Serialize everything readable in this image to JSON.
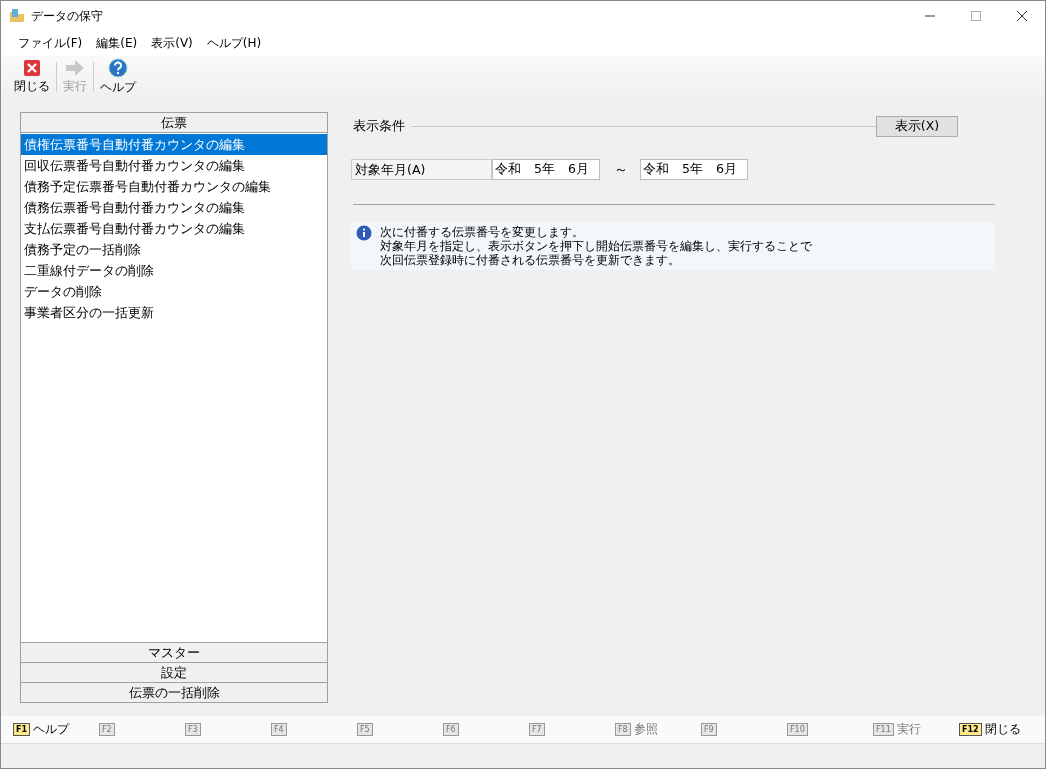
{
  "window": {
    "title": "データの保守"
  },
  "menu": [
    "ファイル(F)",
    "編集(E)",
    "表示(V)",
    "ヘルプ(H)"
  ],
  "toolbar": [
    {
      "kind": "close",
      "label": "閉じる",
      "disabled": false
    },
    {
      "kind": "run",
      "label": "実行",
      "disabled": true
    },
    {
      "kind": "help",
      "label": "ヘルプ",
      "disabled": false
    }
  ],
  "sections": [
    {
      "title": "伝票",
      "items": [
        {
          "label": "債権伝票番号自動付番カウンタの編集",
          "selected": true
        },
        {
          "label": "回収伝票番号自動付番カウンタの編集",
          "selected": false
        },
        {
          "label": "債務予定伝票番号自動付番カウンタの編集",
          "selected": false
        },
        {
          "label": "債務伝票番号自動付番カウンタの編集",
          "selected": false
        },
        {
          "label": "支払伝票番号自動付番カウンタの編集",
          "selected": false
        },
        {
          "label": "債務予定の一括削除",
          "selected": false
        },
        {
          "label": "二重線付データの削除",
          "selected": false
        },
        {
          "label": "データの削除",
          "selected": false
        },
        {
          "label": "事業者区分の一括更新",
          "selected": false
        }
      ]
    },
    {
      "title": "マスター"
    },
    {
      "title": "設定"
    },
    {
      "title": "伝票の一括削除"
    }
  ],
  "conditions": {
    "title": "表示条件",
    "button": "表示(X)",
    "field_label": "対象年月(A)",
    "from": "令和　5年　6月",
    "separator": "～",
    "to": "令和　5年　6月"
  },
  "info": [
    "次に付番する伝票番号を変更します。",
    "対象年月を指定し、表示ボタンを押下し開始伝票番号を編集し、実行することで",
    "次回伝票登録時に付番される伝票番号を更新できます。"
  ],
  "function_keys": [
    {
      "key": "F1",
      "label": "ヘルプ",
      "disabled": false
    },
    {
      "key": "F2",
      "disabled": true
    },
    {
      "key": "F3",
      "disabled": true
    },
    {
      "key": "F4",
      "disabled": true
    },
    {
      "key": "F5",
      "disabled": true
    },
    {
      "key": "F6",
      "disabled": true
    },
    {
      "key": "F7",
      "disabled": true
    },
    {
      "key": "F8",
      "label": "参照",
      "disabled": true
    },
    {
      "key": "F9",
      "disabled": true
    },
    {
      "key": "F10",
      "disabled": true
    },
    {
      "key": "F11",
      "label": "実行",
      "disabled": true
    },
    {
      "key": "F12",
      "label": "閉じる",
      "disabled": false
    }
  ]
}
